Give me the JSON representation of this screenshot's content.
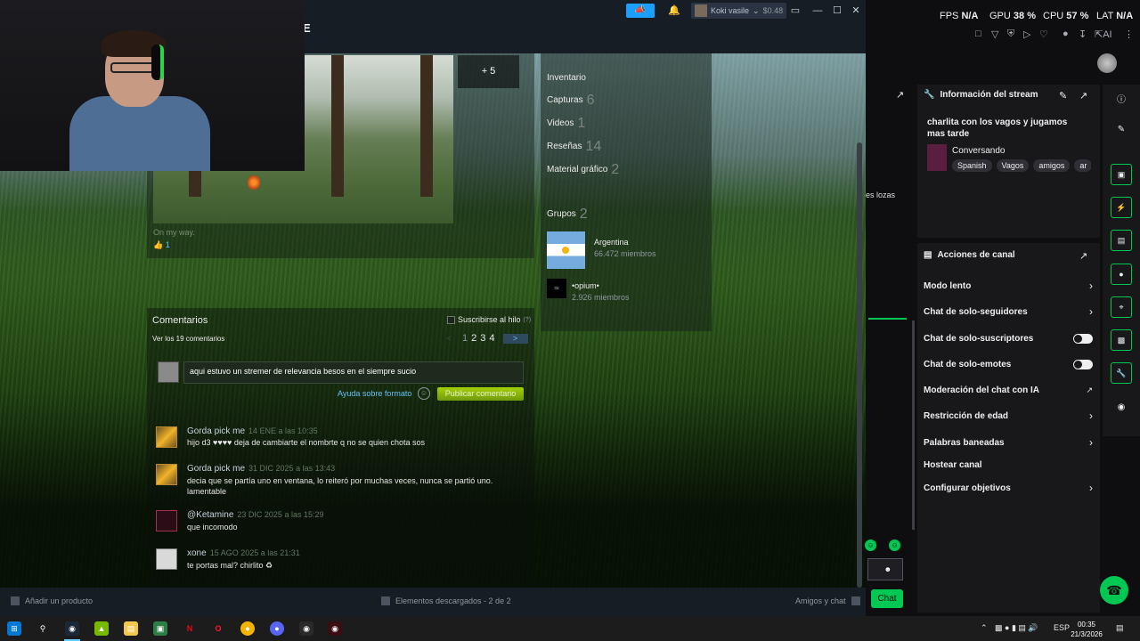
{
  "steam": {
    "app_title": "E",
    "titlebar": {
      "announce_icon": "megaphone-icon",
      "bell_icon": "bell-icon",
      "user_name": "Koki vasile",
      "balance": "$0.48"
    },
    "screenshot": {
      "more_label": "+ 5",
      "caption": "On my way.",
      "likes": "1"
    },
    "profile_links": [
      {
        "label": "Inventario",
        "count": ""
      },
      {
        "label": "Capturas",
        "count": "6"
      },
      {
        "label": "Videos",
        "count": "1"
      },
      {
        "label": "Reseñas",
        "count": "14"
      },
      {
        "label": "Material gráfico",
        "count": "2"
      }
    ],
    "groups": {
      "label": "Grupos",
      "count": "2",
      "items": [
        {
          "name": "Argentina",
          "members": "66.472 miembros"
        },
        {
          "name": "•opium•",
          "members": "2.926 miembros"
        }
      ]
    },
    "comments": {
      "title": "Comentarios",
      "subscribe_label": "Suscribirse al hilo",
      "help_mark": "(?)",
      "view_all": "Ver los 19 comentarios",
      "pages": [
        "1",
        "2",
        "3",
        "4"
      ],
      "input_value": "aqui estuvo un stremer de relevancia besos en el siempre sucio",
      "format_help": "Ayuda sobre formato",
      "post_button": "Publicar comentario",
      "items": [
        {
          "name": "Gorda pick me",
          "date": "14 ENE a las 10:35",
          "text": "hijo d3 ♥♥♥♥ deja de cambiarte el nombrte q no se quien chota sos"
        },
        {
          "name": "Gorda pick me",
          "date": "31 DIC 2025 a las 13:43",
          "text": "decia que se partía uno en ventana, lo reiteró por muchas veces, nunca se partió uno. lamentable"
        },
        {
          "name": "@Ketamine",
          "date": "23 DIC 2025 a las 15:29",
          "text": "que incomodo"
        },
        {
          "name": "xone",
          "date": "15 AGO 2025 a las 21:31",
          "text": "te portas mal? chirlito ♻"
        }
      ]
    },
    "footer": {
      "add_product": "Añadir un producto",
      "downloads": "Elementos descargados - 2 de 2",
      "friends_chat": "Amigos y chat"
    }
  },
  "stats": {
    "fps_label": "FPS",
    "fps_value": "N/A",
    "gpu_label": "GPU",
    "gpu_value": "38 %",
    "cpu_label": "CPU",
    "cpu_value": "57 %",
    "lat_label": "LAT",
    "lat_value": "N/A",
    "ai_label": "AI"
  },
  "twitch": {
    "chat_fragment": "es lozas",
    "stream_info": {
      "title": "Información del stream",
      "stream_title": "charlita con los vagos y jugamos mas tarde",
      "category": "Conversando",
      "tags": [
        "Spanish",
        "Vagos",
        "amigos",
        "ar"
      ]
    },
    "channel_actions": {
      "title": "Acciones de canal",
      "items": [
        {
          "label": "Modo lento",
          "control": "chevron"
        },
        {
          "label": "Chat de solo-seguidores",
          "control": "chevron"
        },
        {
          "label": "Chat de solo-suscriptores",
          "control": "toggle"
        },
        {
          "label": "Chat de solo-emotes",
          "control": "toggle"
        },
        {
          "label": "Moderación del chat con IA",
          "control": "external"
        },
        {
          "label": "Restricción de edad",
          "control": "chevron"
        },
        {
          "label": "Palabras baneadas",
          "control": "chevron"
        },
        {
          "label": "Hostear canal",
          "control": "none"
        },
        {
          "label": "Configurar objetivos",
          "control": "chevron"
        }
      ]
    },
    "chat_button": "Chat"
  },
  "taskbar": {
    "language": "ESP",
    "time": "00:35",
    "date": "21/3/2026"
  },
  "colors": {
    "steam_accent": "#1a9fff",
    "post_button": "#a4d007",
    "twitch_green": "#00c853"
  }
}
